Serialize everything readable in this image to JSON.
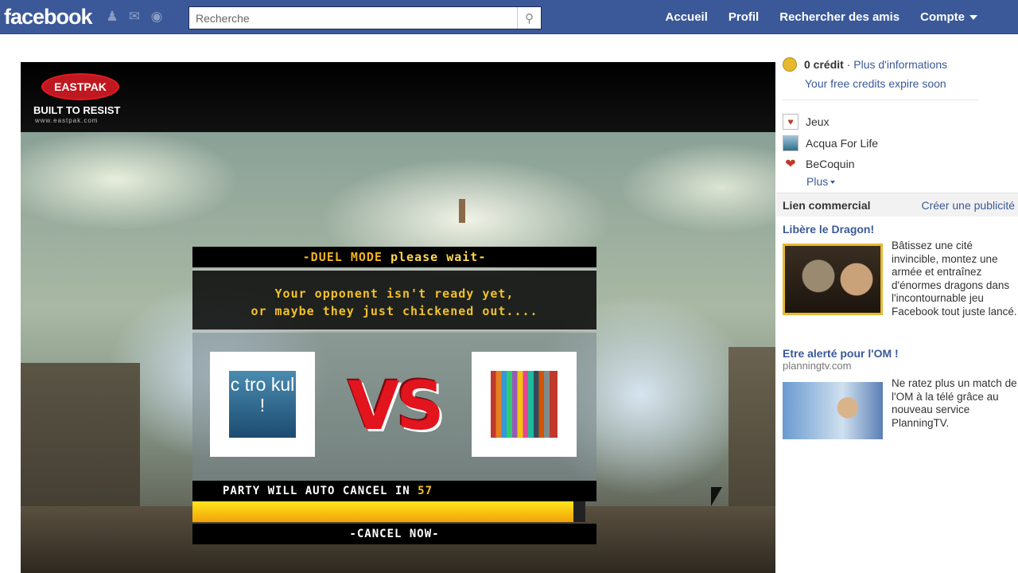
{
  "topbar": {
    "logo": "facebook",
    "search_placeholder": "Recherche",
    "nav": [
      "Accueil",
      "Profil",
      "Rechercher des amis",
      "Compte"
    ],
    "icons": [
      "friends-icon",
      "messages-icon",
      "notifications-icon",
      "search-icon"
    ]
  },
  "game": {
    "brand": "EASTPAK",
    "tagline": "BUILT TO RESIST",
    "url": "www.eastpak.com",
    "duel": {
      "title_prefix": "-DUEL MODE",
      "title_suffix": "please wait-",
      "message_line1": "Your opponent isn't ready yet,",
      "message_line2": "or maybe they just chickened out....",
      "left_avatar_text": "c tro kul !",
      "vs": "VS",
      "countdown_label": "PARTY WILL AUTO CANCEL IN",
      "countdown_value": "57",
      "countdown_progress": 0.97,
      "cancel": "-CANCEL NOW-"
    }
  },
  "sidebar": {
    "credits_count": "0 crédit",
    "credits_sep": " · ",
    "credits_link": "Plus d'informations",
    "credits_expire": "Your free credits expire soon",
    "apps": [
      {
        "label": "Jeux",
        "icon": "jeux-icon"
      },
      {
        "label": "Acqua For Life",
        "icon": "acqua-icon"
      },
      {
        "label": "BeCoquin",
        "icon": "becoquin-icon"
      }
    ],
    "more": "Plus",
    "ads_header": "Lien commercial",
    "ads_create": "Créer une publicité",
    "ads": [
      {
        "title": "Libère le Dragon!",
        "domain": "",
        "text": "Bâtissez une cité invincible, montez une armée et entraînez d'énormes dragons dans l'incontournable jeu Facebook tout juste lancé."
      },
      {
        "title": "Etre alerté pour l'OM !",
        "domain": "planningtv.com",
        "text": "Ne ratez plus un match de l'OM à la télé grâce au nouveau service PlanningTV."
      }
    ]
  },
  "colors": {
    "facebook_blue": "#3b5998",
    "link": "#3b5998",
    "duel_gold": "#f2c02a",
    "vs_red": "#e2141e"
  }
}
